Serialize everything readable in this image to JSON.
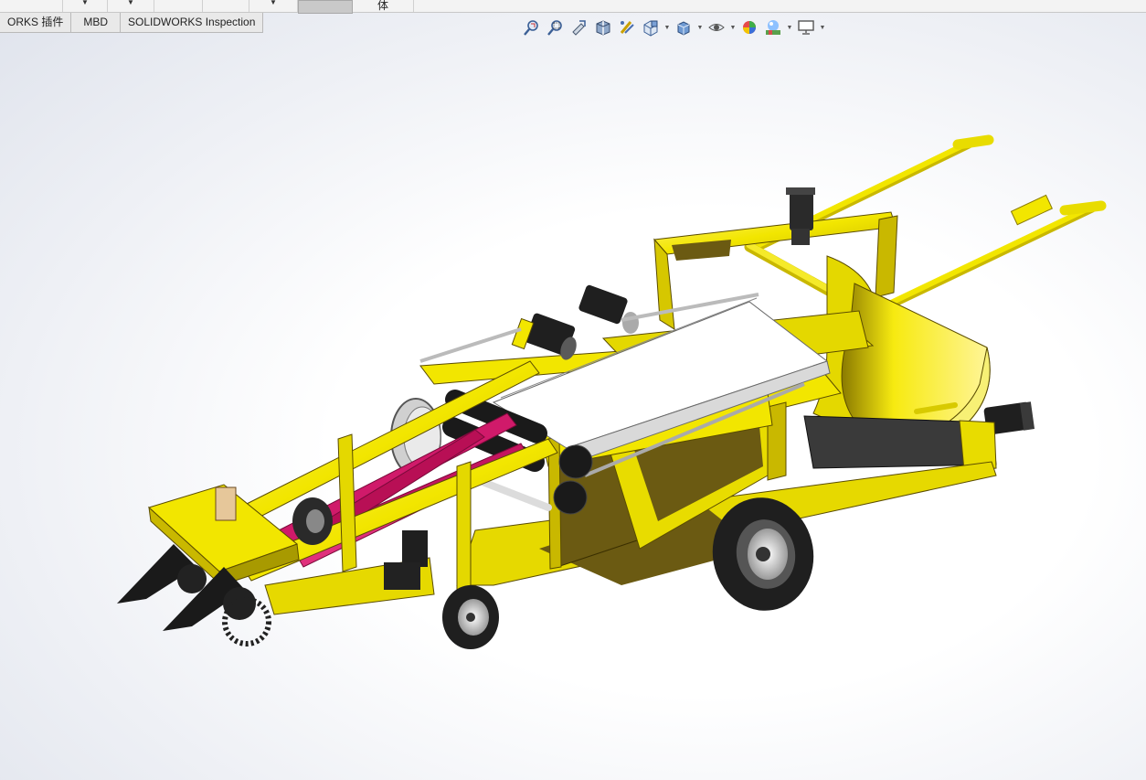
{
  "top_toolbar": {
    "partial_label": "体"
  },
  "tabs": [
    {
      "label": "ORKS 插件"
    },
    {
      "label": "MBD"
    },
    {
      "label": "SOLIDWORKS Inspection"
    }
  ],
  "view_toolbar": {
    "icons": [
      "zoom-to-fit-icon",
      "zoom-to-area-icon",
      "previous-view-icon",
      "section-view-icon",
      "dynamic-annotation-icon",
      "view-orientation-icon",
      "display-style-icon",
      "hide-show-items-icon",
      "edit-appearance-icon",
      "apply-scene-icon",
      "view-settings-icon"
    ]
  },
  "model": {
    "name": "",
    "colors": {
      "frame": "#f2e600",
      "frame_shadow": "#6b5a12",
      "belt": "#d01a6a",
      "conveyor": "#ffffff",
      "tire": "#1f1f1f",
      "motor": "#2a2a2a"
    }
  }
}
